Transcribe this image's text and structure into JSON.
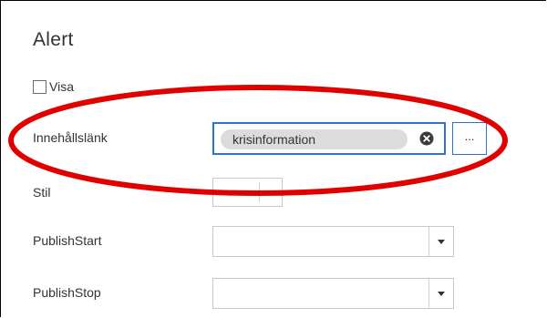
{
  "title": "Alert",
  "visa": {
    "label": "Visa",
    "checked": false
  },
  "content_link": {
    "label": "Innehållslänk",
    "value": "krisinformation",
    "browse_label": "..."
  },
  "style": {
    "label": "Stil",
    "value": ""
  },
  "publish_start": {
    "label": "PublishStart",
    "value": ""
  },
  "publish_stop": {
    "label": "PublishStop",
    "value": ""
  },
  "colors": {
    "focus_border": "#2f6fcf",
    "tag_background": "#dcdcdc",
    "annotation": "#e00000"
  },
  "icons": {
    "clear": "close-circle-icon",
    "select_caret": "caret-down-icon"
  }
}
